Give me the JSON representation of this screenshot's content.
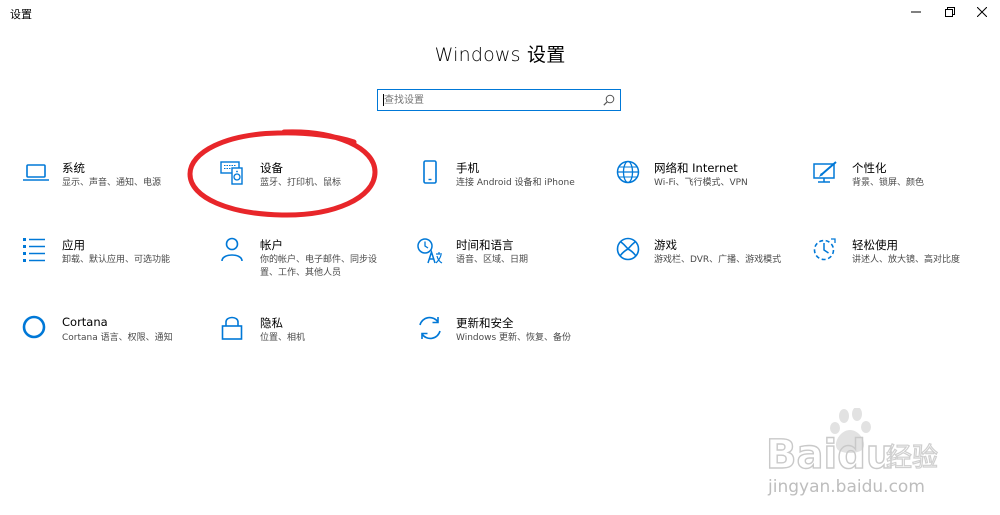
{
  "window": {
    "title": "设置",
    "controls": {
      "minimize_icon": "minimize-icon",
      "maximize_icon": "restore-icon",
      "close_icon": "close-icon"
    }
  },
  "page": {
    "title": "Windows 设置"
  },
  "search": {
    "placeholder": "查找设置",
    "value": ""
  },
  "tiles": [
    {
      "id": "system",
      "title": "系统",
      "desc": "显示、声音、通知、电源",
      "icon": "laptop-icon"
    },
    {
      "id": "devices",
      "title": "设备",
      "desc": "蓝牙、打印机、鼠标",
      "icon": "devices-icon"
    },
    {
      "id": "phone",
      "title": "手机",
      "desc": "连接 Android 设备和 iPhone",
      "icon": "phone-icon"
    },
    {
      "id": "network",
      "title": "网络和 Internet",
      "desc": "Wi-Fi、飞行模式、VPN",
      "icon": "globe-icon"
    },
    {
      "id": "personalization",
      "title": "个性化",
      "desc": "背景、锁屏、颜色",
      "icon": "paint-icon"
    },
    {
      "id": "apps",
      "title": "应用",
      "desc": "卸载、默认应用、可选功能",
      "icon": "apps-list-icon"
    },
    {
      "id": "accounts",
      "title": "帐户",
      "desc": "你的帐户、电子邮件、同步设置、工作、其他人员",
      "icon": "person-icon"
    },
    {
      "id": "time",
      "title": "时间和语言",
      "desc": "语音、区域、日期",
      "icon": "time-language-icon"
    },
    {
      "id": "gaming",
      "title": "游戏",
      "desc": "游戏栏、DVR、广播、游戏模式",
      "icon": "xbox-icon"
    },
    {
      "id": "ease",
      "title": "轻松使用",
      "desc": "讲述人、放大镜、高对比度",
      "icon": "ease-of-access-icon"
    },
    {
      "id": "cortana",
      "title": "Cortana",
      "desc": "Cortana 语言、权限、通知",
      "icon": "cortana-icon"
    },
    {
      "id": "privacy",
      "title": "隐私",
      "desc": "位置、相机",
      "icon": "lock-icon"
    },
    {
      "id": "update",
      "title": "更新和安全",
      "desc": "Windows 更新、恢复、备份",
      "icon": "sync-icon"
    }
  ],
  "annotation": {
    "color": "#e8262a",
    "target": "devices"
  },
  "watermark": {
    "brand": "Baidu",
    "brand_cn": "经验",
    "url": "jingyan.baidu.com"
  },
  "colors": {
    "accent": "#0078d7",
    "text": "#000000",
    "subtext": "#4a4a4a"
  }
}
